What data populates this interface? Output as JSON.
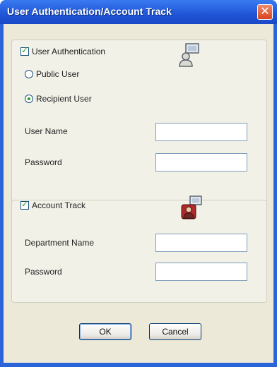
{
  "window": {
    "title": "User Authentication/Account Track",
    "close_glyph": "✕"
  },
  "user_auth": {
    "checkbox_label": "User Authentication",
    "checked": true,
    "radios": [
      {
        "label": "Public User",
        "selected": false
      },
      {
        "label": "Recipient User",
        "selected": true
      }
    ],
    "fields": [
      {
        "label": "User Name",
        "value": ""
      },
      {
        "label": "Password",
        "value": ""
      }
    ],
    "icon": "user-computer-icon"
  },
  "account_track": {
    "checkbox_label": "Account Track",
    "checked": true,
    "fields": [
      {
        "label": "Department Name",
        "value": ""
      },
      {
        "label": "Password",
        "value": ""
      }
    ],
    "icon": "account-user-icon"
  },
  "buttons": {
    "ok": "OK",
    "cancel": "Cancel"
  },
  "colors": {
    "titlebar": "#1f55d6",
    "close": "#d8431f",
    "dialog_bg": "#ece9d8"
  }
}
